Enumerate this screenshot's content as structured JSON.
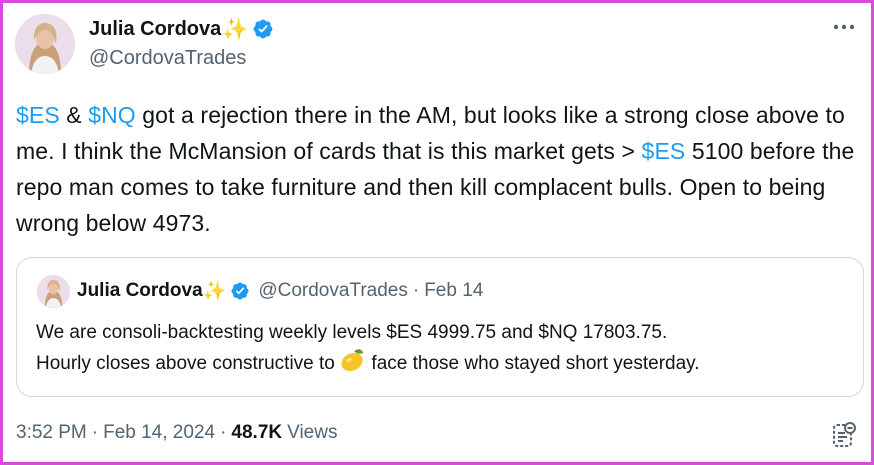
{
  "author": {
    "name": "Julia Cordova",
    "emoji": "✨",
    "handle": "@CordovaTrades",
    "verified": true
  },
  "tweet": {
    "segments": [
      {
        "text": "$ES",
        "cashtag": true
      },
      {
        "text": " & ",
        "cashtag": false
      },
      {
        "text": "$NQ",
        "cashtag": true
      },
      {
        "text": " got a rejection there in the AM, but looks like a strong close above to me.  I think the McMansion of cards that is this market gets > ",
        "cashtag": false
      },
      {
        "text": "$ES",
        "cashtag": true
      },
      {
        "text": " 5100 before the repo man comes to take furniture and then kill complacent bulls.   Open to being wrong below 4973.",
        "cashtag": false
      }
    ]
  },
  "quoted": {
    "name": "Julia Cordova",
    "emoji": "✨",
    "handle": "@CordovaTrades",
    "separator": "·",
    "date": "Feb 14",
    "text_line1": "We are consoli-backtesting weekly levels $ES 4999.75 and $NQ 17803.75.",
    "text_line2_before": "Hourly closes above constructive to ",
    "lemon_icon": "lemon-emoji",
    "text_line2_after": " face those who stayed short yesterday."
  },
  "footer": {
    "time": "3:52 PM",
    "separator": "·",
    "date": "Feb 14, 2024",
    "views_count": "48.7K",
    "views_label": "Views"
  },
  "colors": {
    "frame_border": "#d94bd9",
    "cashtag": "#1d9bf0",
    "verified": "#1d9bf0",
    "secondary_text": "#536471"
  }
}
